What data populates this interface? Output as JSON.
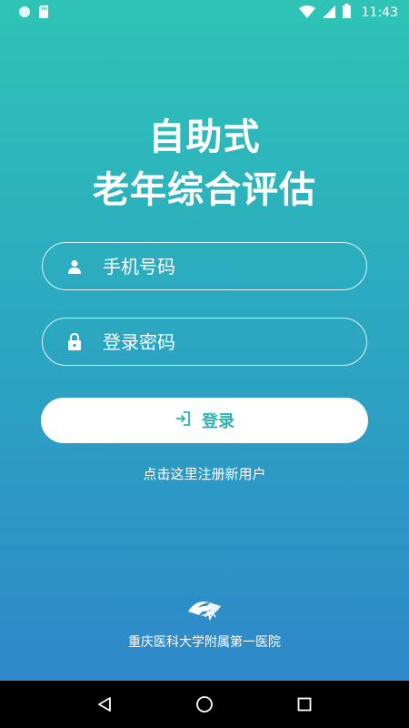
{
  "status_bar": {
    "time": "11:43",
    "icons": [
      "notification-dot-icon",
      "sd-card-icon",
      "wifi-icon",
      "cell-signal-icon",
      "battery-icon"
    ]
  },
  "title": {
    "line1": "自助式",
    "line2": "老年综合评估"
  },
  "form": {
    "phone_placeholder": "手机号码",
    "password_placeholder": "登录密码",
    "login_label": "登录"
  },
  "register_link": "点击这里注册新用户",
  "footer": {
    "hospital_name": "重庆医科大学附属第一医院"
  },
  "colors": {
    "gradient_top": "#2fc4b6",
    "gradient_bottom": "#2e88c9",
    "accent": "#2bb5b0"
  },
  "nav": {
    "icons": [
      "back-icon",
      "home-icon",
      "recents-icon"
    ]
  }
}
